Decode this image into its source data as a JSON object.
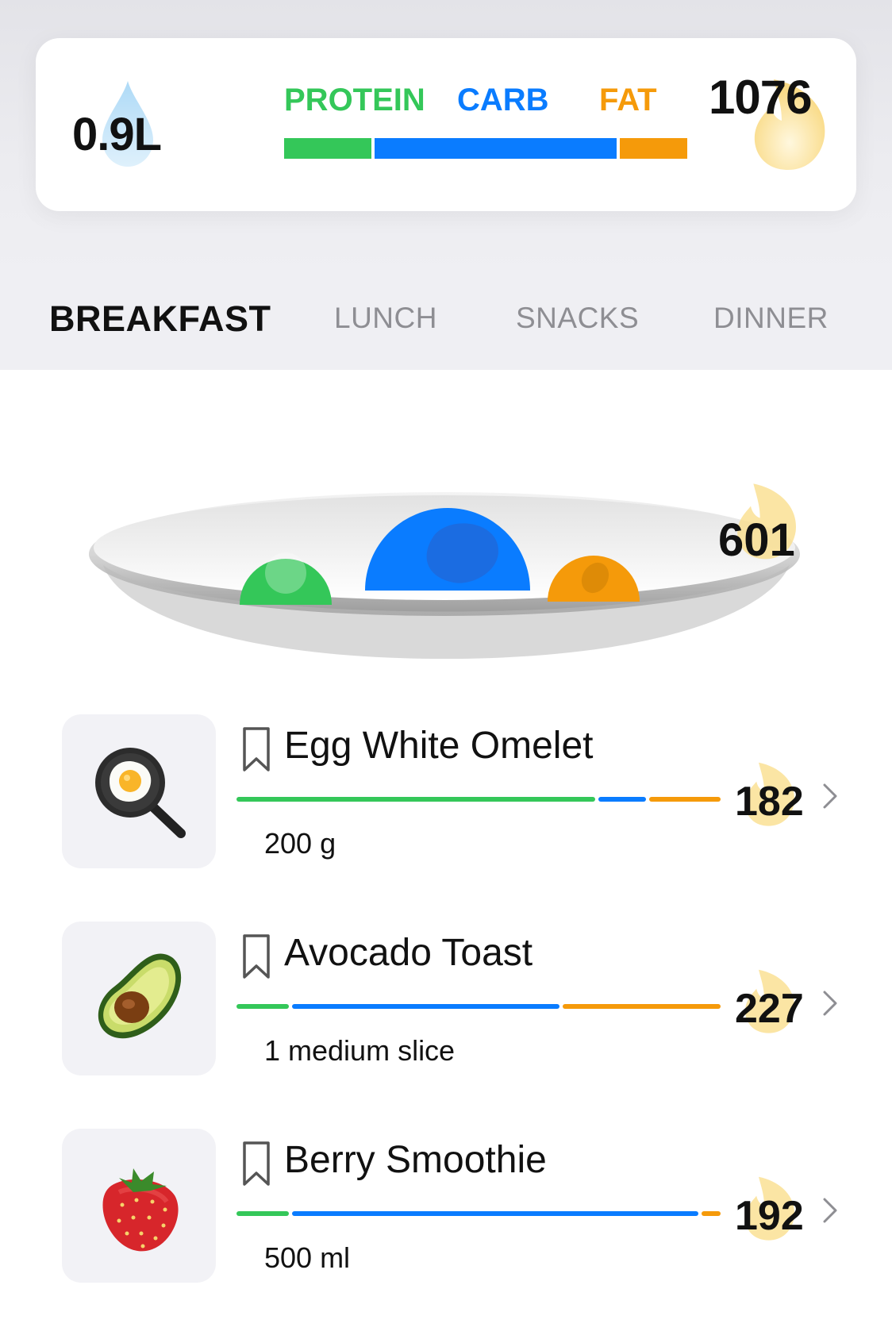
{
  "summary": {
    "water": "0.9L",
    "calories": "1076",
    "macros": [
      {
        "label": "PROTEIN",
        "color": "#34c759",
        "fraction": 0.22
      },
      {
        "label": "CARB",
        "color": "#0a7cff",
        "fraction": 0.61
      },
      {
        "label": "FAT",
        "color": "#f59a0a",
        "fraction": 0.17
      }
    ]
  },
  "tabs": [
    {
      "label": "BREAKFAST",
      "active": true
    },
    {
      "label": "LUNCH",
      "active": false
    },
    {
      "label": "SNACKS",
      "active": false
    },
    {
      "label": "DINNER",
      "active": false
    }
  ],
  "plate": {
    "calories": "601",
    "bubbles": [
      {
        "name": "protein",
        "color": "#34c759",
        "icon": "frying-pan-egg-icon"
      },
      {
        "name": "carb",
        "color": "#0a7cff",
        "icon": "strawberry-icon"
      },
      {
        "name": "fat",
        "color": "#f59a0a",
        "icon": "avocado-icon"
      }
    ]
  },
  "foods": [
    {
      "name": "Egg White Omelet",
      "portion": "200 g",
      "calories": "182",
      "icon": "frying-pan-egg-icon",
      "macro_fractions": {
        "protein": 0.75,
        "carb": 0.1,
        "fat": 0.15
      }
    },
    {
      "name": "Avocado Toast",
      "portion": "1 medium slice",
      "calories": "227",
      "icon": "avocado-icon",
      "macro_fractions": {
        "protein": 0.11,
        "carb": 0.56,
        "fat": 0.33
      }
    },
    {
      "name": "Berry Smoothie",
      "portion": "500 ml",
      "calories": "192",
      "icon": "strawberry-icon",
      "macro_fractions": {
        "protein": 0.11,
        "carb": 0.85,
        "fat": 0.04
      }
    }
  ]
}
